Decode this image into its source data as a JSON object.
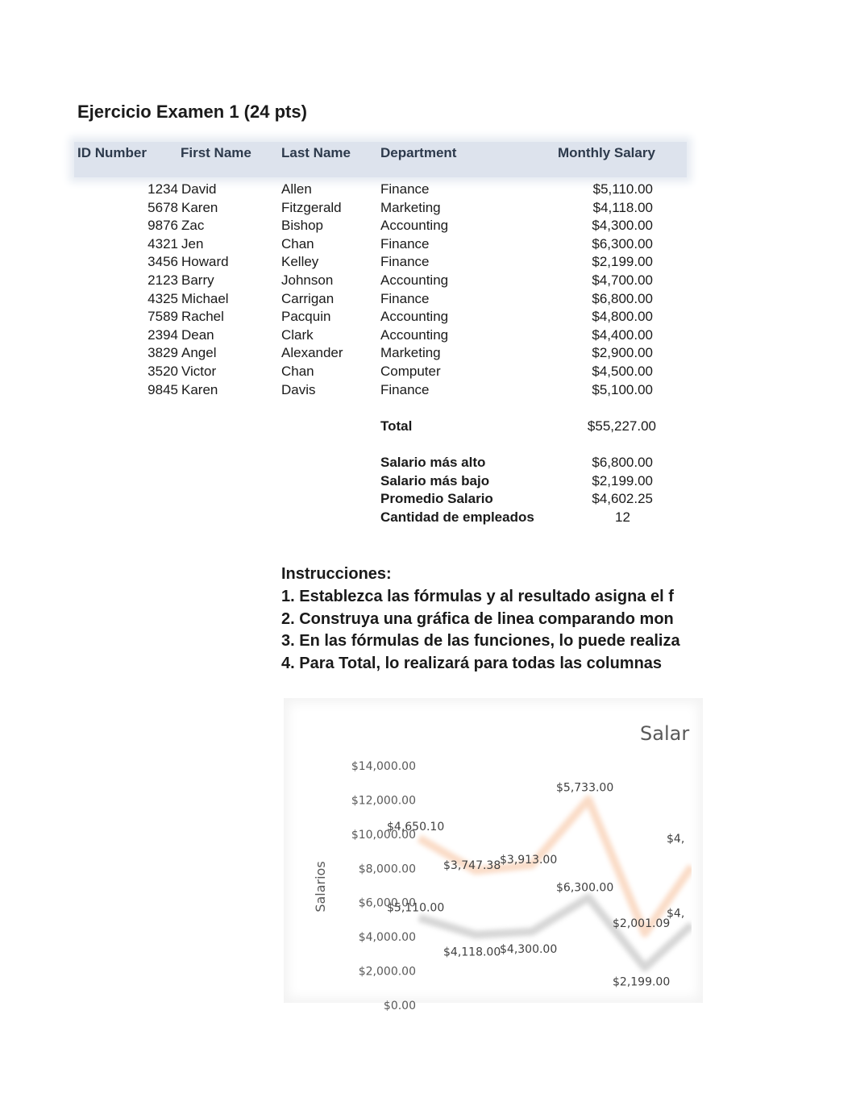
{
  "title": "Ejercicio Examen 1 (24 pts)",
  "table": {
    "headers": [
      "ID Number",
      "First Name",
      "Last Name",
      "Department",
      "Monthly Salary"
    ],
    "rows": [
      [
        "1234",
        "David",
        "Allen",
        "Finance",
        "$5,110.00"
      ],
      [
        "5678",
        "Karen",
        "Fitzgerald",
        "Marketing",
        "$4,118.00"
      ],
      [
        "9876",
        "Zac",
        "Bishop",
        "Accounting",
        "$4,300.00"
      ],
      [
        "4321",
        "Jen",
        "Chan",
        "Finance",
        "$6,300.00"
      ],
      [
        "3456",
        "Howard",
        "Kelley",
        "Finance",
        "$2,199.00"
      ],
      [
        "2123",
        "Barry",
        "Johnson",
        "Accounting",
        "$4,700.00"
      ],
      [
        "4325",
        "Michael",
        "Carrigan",
        "Finance",
        "$6,800.00"
      ],
      [
        "7589",
        "Rachel",
        "Pacquin",
        "Accounting",
        "$4,800.00"
      ],
      [
        "2394",
        "Dean",
        "Clark",
        "Accounting",
        "$4,400.00"
      ],
      [
        "3829",
        "Angel",
        "Alexander",
        "Marketing",
        "$2,900.00"
      ],
      [
        "3520",
        "Victor",
        "Chan",
        "Computer",
        "$4,500.00"
      ],
      [
        "9845",
        "Karen",
        "Davis",
        "Finance",
        "$5,100.00"
      ]
    ],
    "total_label": "Total",
    "total_value": "$55,227.00",
    "stats": [
      {
        "label": "Salario más alto",
        "value": "$6,800.00"
      },
      {
        "label": "Salario más bajo",
        "value": "$2,199.00"
      },
      {
        "label": "Promedio Salario",
        "value": "$4,602.25"
      },
      {
        "label": "Cantidad de empleados",
        "value": "12"
      }
    ]
  },
  "instructions": {
    "heading": "Instrucciones:",
    "items": [
      "1. Establezca las fórmulas y al resultado asigna el f",
      "2. Construya una gráfica de linea comparando mon",
      "3. En las fórmulas de las funciones, lo puede realiza",
      "4. Para Total, lo realizará para todas las columnas"
    ]
  },
  "chart_data": {
    "type": "line",
    "stacked": true,
    "title": "Salar",
    "ylabel": "Salarios",
    "ylim": [
      0,
      14000
    ],
    "yticks": [
      "$0.00",
      "$2,000.00",
      "$4,000.00",
      "$6,000.00",
      "$8,000.00",
      "$10,000.00",
      "$12,000.00",
      "$14,000.00"
    ],
    "grid": true,
    "colors": {
      "series1": "#a5a5a5",
      "series2": "#f4b183"
    },
    "series": [
      {
        "values": [
          5110,
          4118,
          4300,
          6300,
          2199,
          4700
        ],
        "labels": [
          "$5,110.00",
          "$4,118.00",
          "$4,300.00",
          "$6,300.00",
          "$2,199.00",
          "$4,"
        ]
      },
      {
        "values": [
          4650.1,
          3747.38,
          3913.0,
          5733.0,
          2001.09,
          3400
        ],
        "labels": [
          "$4,650.10",
          "$3,747.38",
          "$3,913.00",
          "$5,733.00",
          "$2,001.09",
          "$4,"
        ]
      }
    ]
  }
}
